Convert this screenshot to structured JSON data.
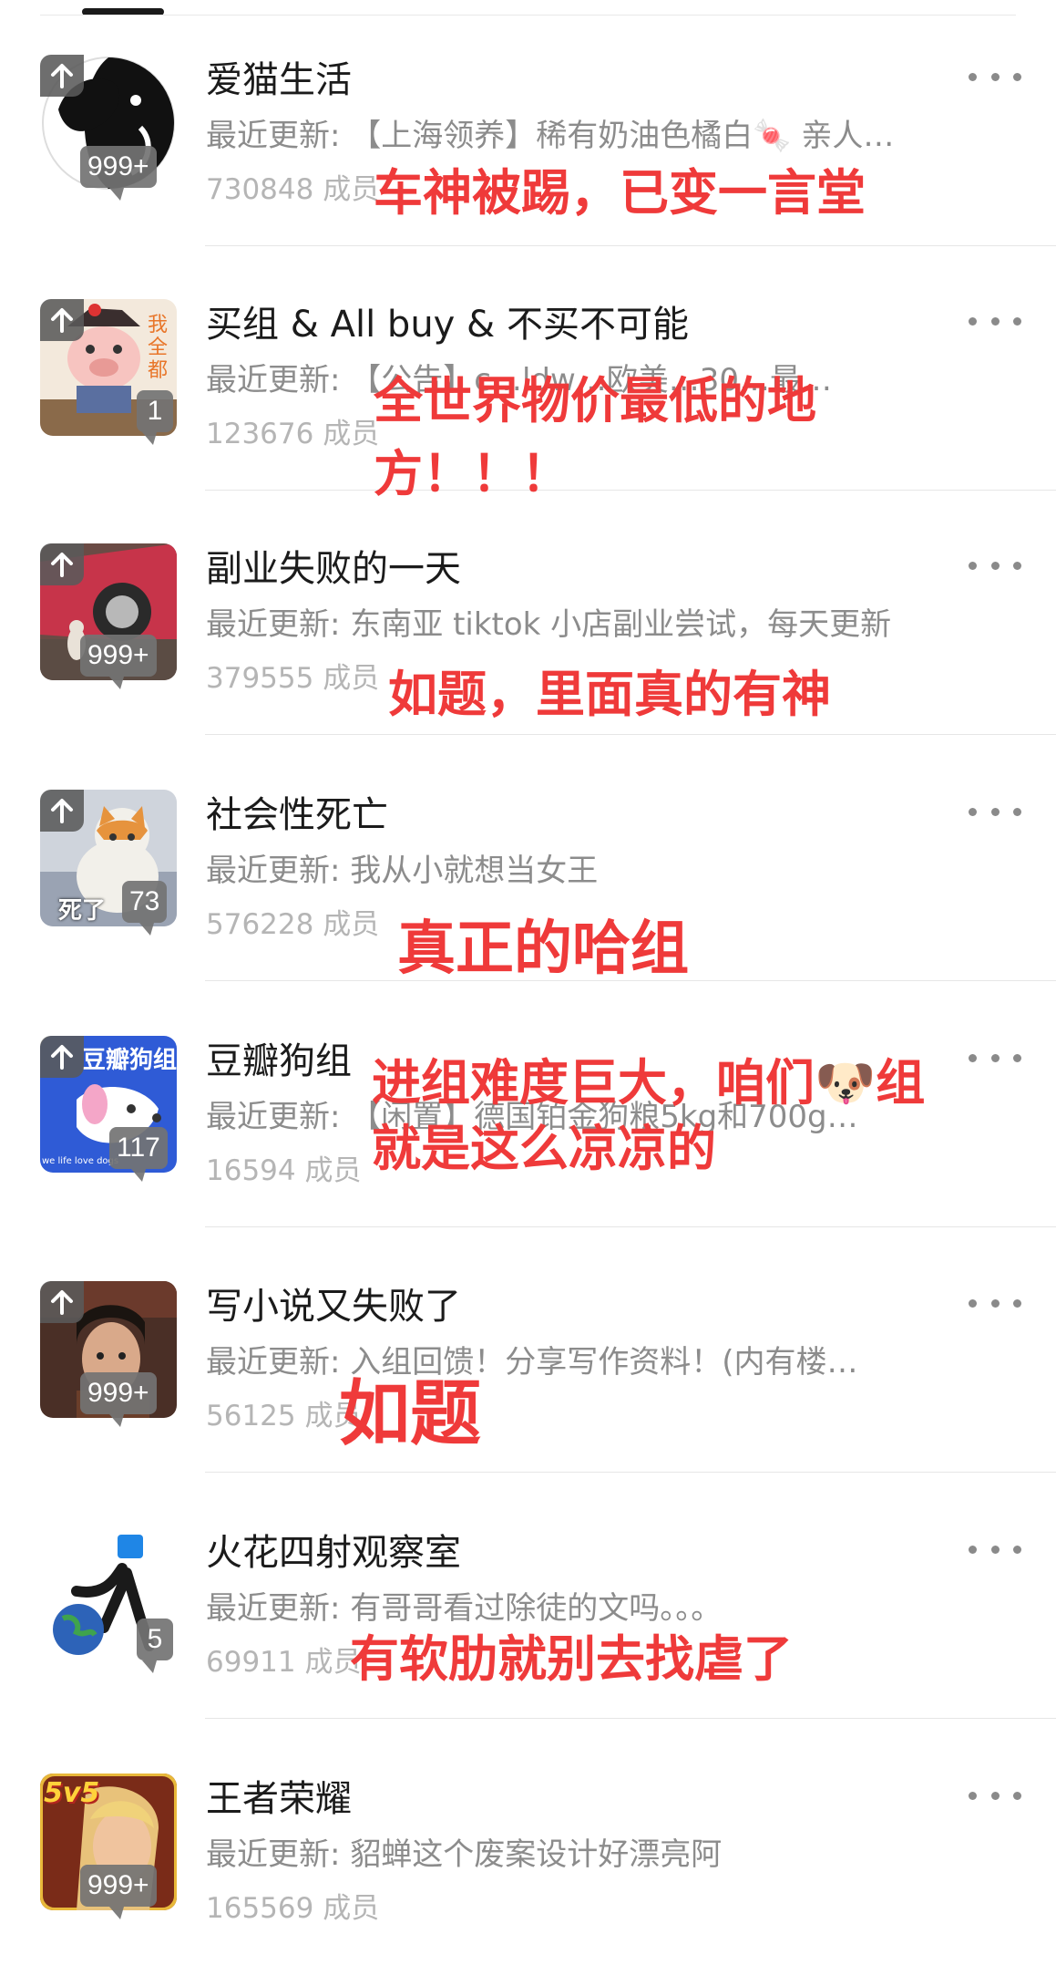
{
  "colors": {
    "annotation": "#ef3a3a",
    "title": "#1b1b1b",
    "subtitle": "#8c8c8c",
    "members": "#b5b5b5",
    "badge": "#737373"
  },
  "groups": [
    {
      "title": "爱猫生活",
      "latest": "最近更新: 【上海领养】稀有奶油色橘白🍬 亲人…",
      "members": "730848 成员",
      "badge": "999+",
      "pinned": true,
      "avatar_icon": "cat-ink-avatar"
    },
    {
      "title": "买组 & All buy & 不买不可能",
      "latest": "最近更新: 【公告】c…ldw…欧美…30…最…",
      "members": "123676 成员",
      "badge": "1",
      "pinned": true,
      "avatar_icon": "pig-cartoon-avatar"
    },
    {
      "title": "副业失败的一天",
      "latest": "最近更新: 东南亚 tiktok 小店副业尝试，每天更新",
      "members": "379555 成员",
      "badge": "999+",
      "pinned": true,
      "avatar_icon": "red-car-cat-avatar"
    },
    {
      "title": "社会性死亡",
      "latest": "最近更新: 我从小就想当女王",
      "members": "576228 成员",
      "badge": "73",
      "pinned": true,
      "avatar_icon": "orange-cat-avatar",
      "avatar_text": "死了"
    },
    {
      "title": "豆瓣狗组",
      "latest": "最近更新: 【闲置】德国铂金狗粮5kg和700g…",
      "members": "16594 成员",
      "badge": "117",
      "pinned": true,
      "avatar_icon": "dog-group-avatar",
      "avatar_text": "豆瓣狗组",
      "avatar_subtext": "we life love dogs"
    },
    {
      "title": "写小说又失败了",
      "latest": "最近更新: 入组回馈！分享写作资料！(内有楼…",
      "members": "56125 成员",
      "badge": "999+",
      "pinned": true,
      "avatar_icon": "drama-girl-avatar"
    },
    {
      "title": "火花四射观察室",
      "latest": "最近更新: 有哥哥看过除徒的文吗。。。",
      "members": "69911 成员",
      "badge": "5",
      "pinned": false,
      "avatar_icon": "globe-runner-avatar"
    },
    {
      "title": "王者荣耀",
      "latest": "最近更新: 貂蝉这个废案设计好漂亮阿",
      "members": "165569 成员",
      "badge": "999+",
      "pinned": false,
      "avatar_icon": "game-hero-avatar",
      "avatar_text": "5v5"
    }
  ],
  "annotations": [
    {
      "text": "车神被踢，已变一言堂"
    },
    {
      "text": "全世界物价最低的地"
    },
    {
      "text": "方！！！"
    },
    {
      "text": "如题，里面真的有神"
    },
    {
      "text": "真正的哈组"
    },
    {
      "text": "进组难度巨大，咱们🐶组"
    },
    {
      "text": "就是这么凉凉的"
    },
    {
      "text": "如题"
    },
    {
      "text": "有软肋就别去找虐了"
    }
  ]
}
